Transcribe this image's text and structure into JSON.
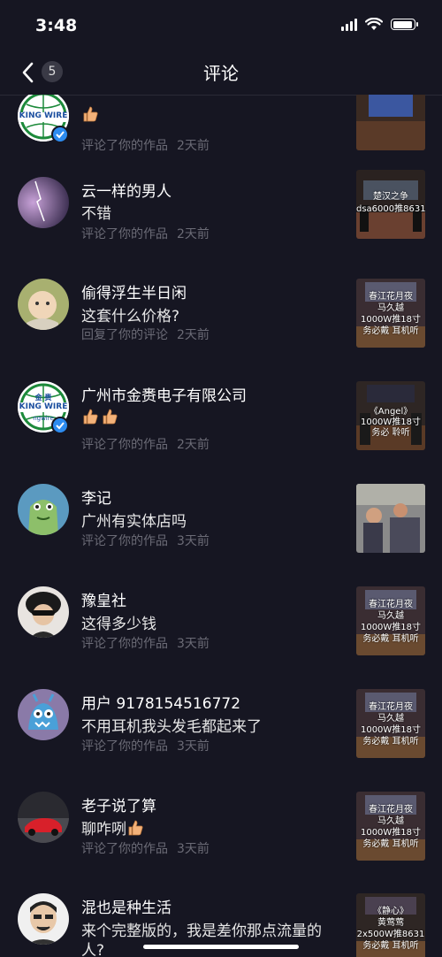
{
  "status": {
    "time": "3:48"
  },
  "nav": {
    "title": "评论",
    "badge": "5"
  },
  "items": [
    {
      "name": "",
      "comment": "",
      "action": "评论了你的作品",
      "ago": "2天前",
      "thumb_lines": []
    },
    {
      "name": "云一样的男人",
      "comment": "不错",
      "action": "评论了你的作品",
      "ago": "2天前",
      "thumb_lines": [
        "楚汉之争",
        "dsa6000推8631"
      ]
    },
    {
      "name": "偷得浮生半日闲",
      "comment": "这套什么价格?",
      "action": "回复了你的评论",
      "ago": "2天前",
      "thumb_lines": [
        "春江花月夜",
        "马久越",
        "1000W推18寸",
        "务必戴 耳机听"
      ]
    },
    {
      "name": "广州市金赉电子有限公司",
      "comment": "",
      "action": "评论了你的作品",
      "ago": "2天前",
      "thumb_lines": [
        "《Angel》",
        "1000W推18寸",
        "务必 聆听"
      ]
    },
    {
      "name": "李记",
      "comment": "广州有实体店吗",
      "action": "评论了你的作品",
      "ago": "3天前",
      "thumb_lines": []
    },
    {
      "name": "豫皇社",
      "comment": "这得多少钱",
      "action": "评论了你的作品",
      "ago": "3天前",
      "thumb_lines": [
        "春江花月夜",
        "马久越",
        "1000W推18寸",
        "务必戴 耳机听"
      ]
    },
    {
      "name": "用户 9178154516772",
      "comment": "不用耳机我头发毛都起来了",
      "action": "评论了你的作品",
      "ago": "3天前",
      "thumb_lines": [
        "春江花月夜",
        "马久越",
        "1000W推18寸",
        "务必戴 耳机听"
      ]
    },
    {
      "name": "老子说了算",
      "comment": "聊咋咧",
      "action": "评论了你的作品",
      "ago": "3天前",
      "thumb_lines": [
        "春江花月夜",
        "马久越",
        "1000W推18寸",
        "务必戴 耳机听"
      ]
    },
    {
      "name": "混也是种生活",
      "comment": "来个完整版的，我是差你那点流量的",
      "comment2": "人?",
      "action": "",
      "ago": "",
      "thumb_lines": [
        "《静心》",
        "黄莺莺",
        "2x500W推8631",
        "务必戴 耳机听"
      ]
    }
  ],
  "logo": {
    "top": "金 赉",
    "main": "KING WIRE",
    "sub": "ngwire"
  }
}
